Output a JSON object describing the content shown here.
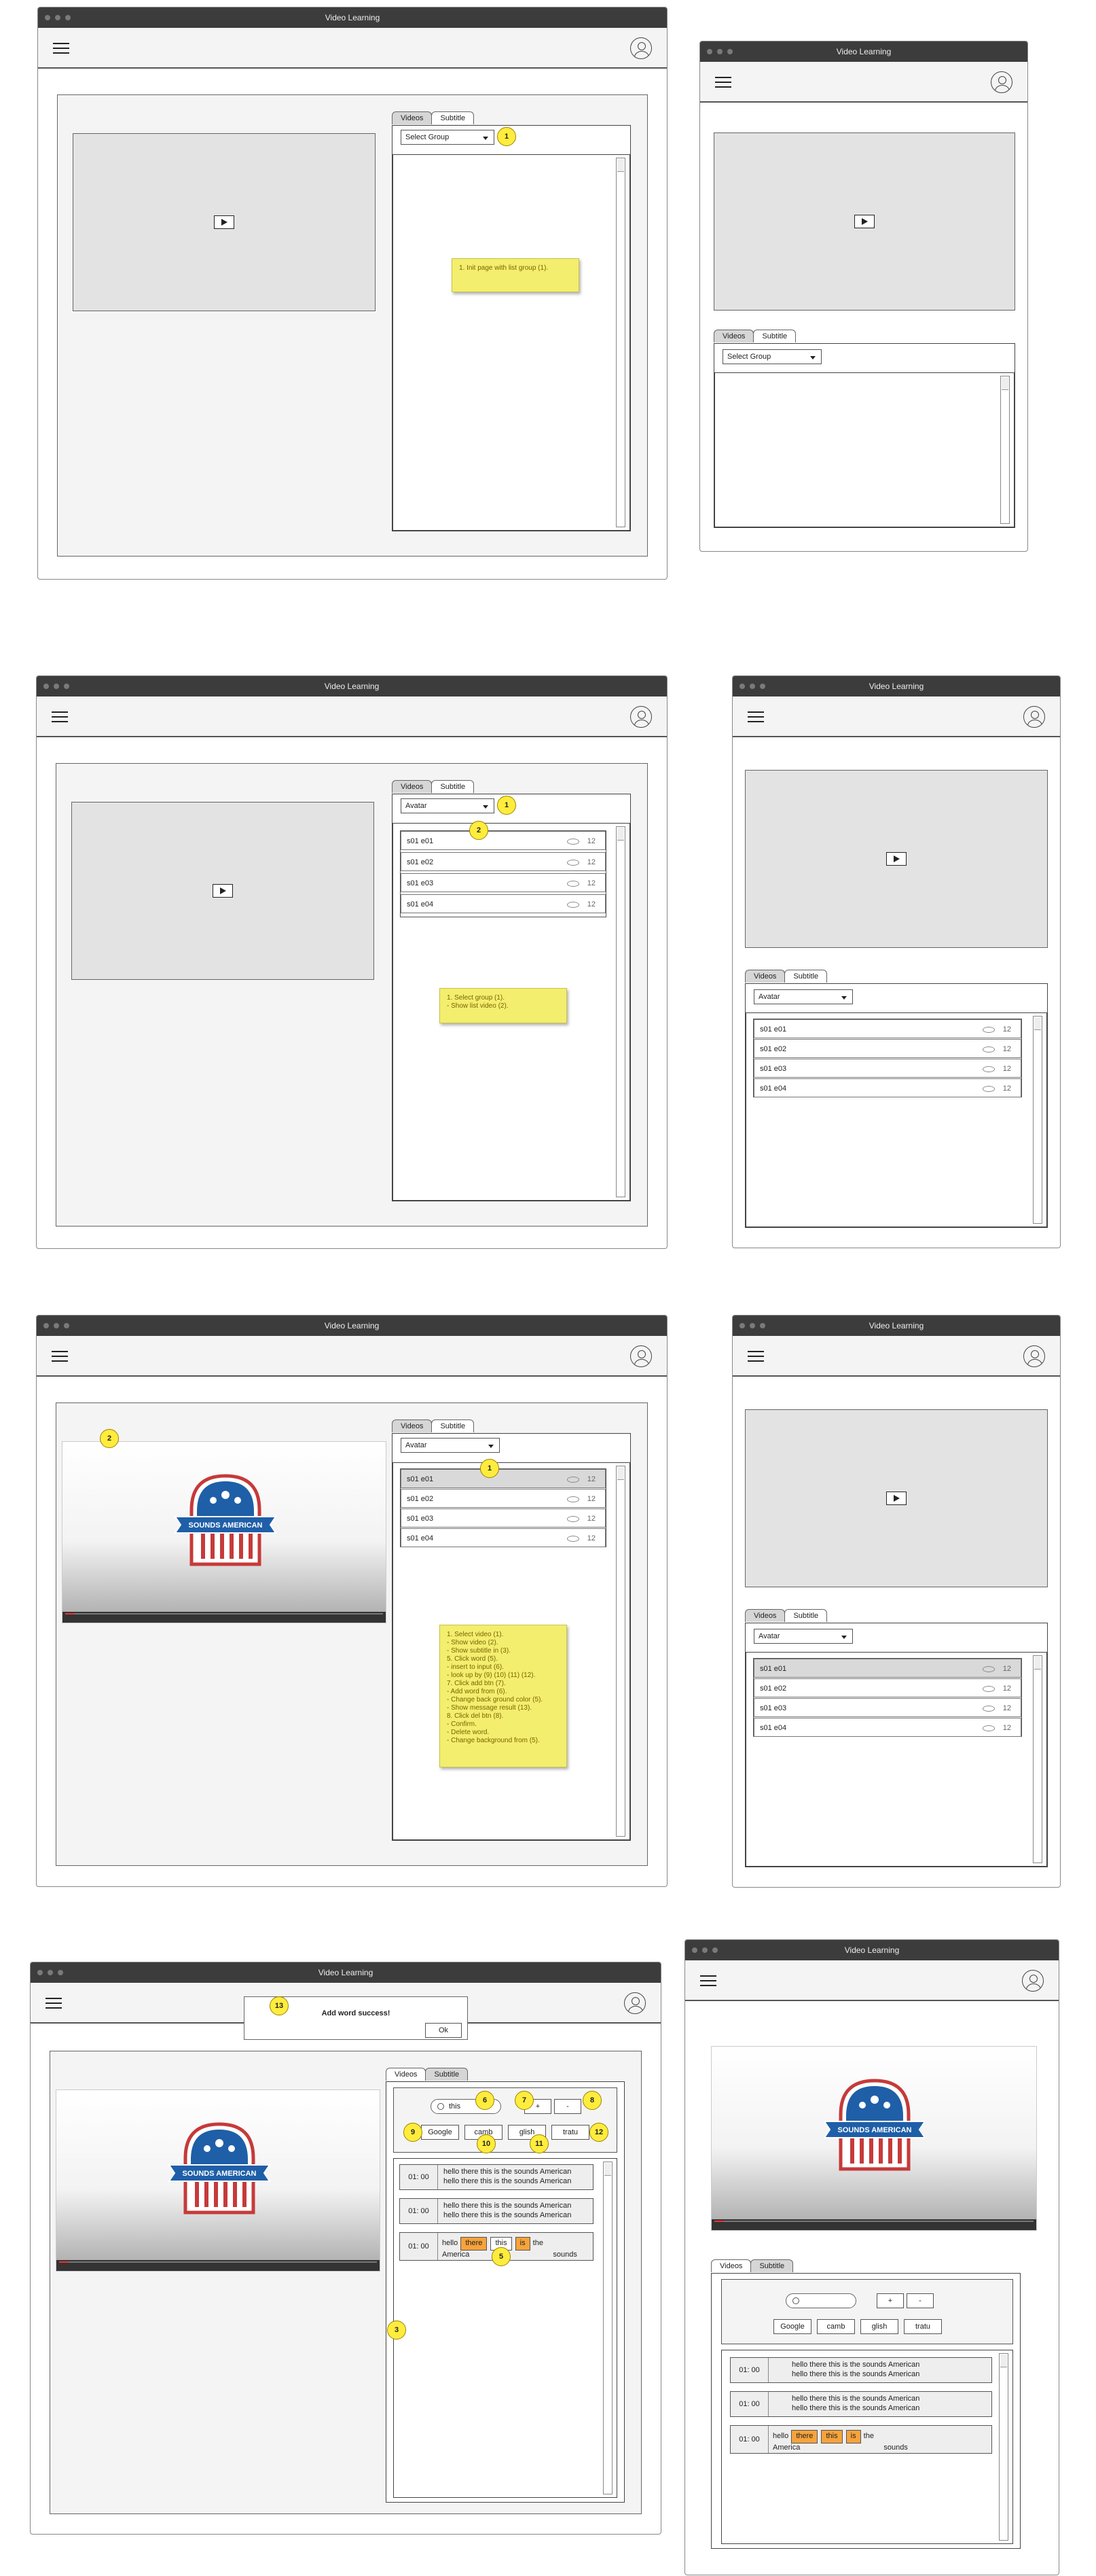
{
  "app": {
    "window_title": "Video Learning"
  },
  "tabs": {
    "videos": "Videos",
    "subtitle": "Subtitle"
  },
  "select": {
    "initial": "Select Group",
    "selected": "Avatar"
  },
  "episodes": [
    {
      "title": "s01 e01",
      "views": "12"
    },
    {
      "title": "s01 e02",
      "views": "12"
    },
    {
      "title": "s01 e03",
      "views": "12"
    },
    {
      "title": "s01 e04",
      "views": "12"
    }
  ],
  "notes": {
    "init": "1. Init page with list group (1).",
    "select": "1. Select group (1).\n- Show list video (2).",
    "video": "1. Select video (1).\n- Show video (2).\n- Show subtitle in (3).\n5. Click word (5).\n- insert to input (6).\n- look up by (9) (10) (11) (12).\n7. Click add btn (7).\n- Add word from (6).\n- Change back ground color (5).\n- Show message result (13).\n8. Click del btn (8).\n- Confirm.\n- Delete word.\n- Change background from (5)."
  },
  "badges": [
    "1",
    "2",
    "3",
    "5",
    "6",
    "7",
    "8",
    "9",
    "10",
    "11",
    "12",
    "13"
  ],
  "subtitle_panel": {
    "search_value": "this",
    "add_label": "+",
    "delete_label": "-",
    "dict_buttons": [
      "Google",
      "camb",
      "glish",
      "tratu"
    ],
    "alert_message": "Add word success!",
    "ok_label": "Ok",
    "rows": [
      {
        "time": "01: 00",
        "line1": "hello there this is the sounds American",
        "line2": "hello there this is the sounds American"
      },
      {
        "time": "01: 00",
        "line1": "hello there this is the sounds American",
        "line2": "hello there this is the sounds American"
      }
    ],
    "word_row": {
      "time": "01: 00",
      "w_hello": "hello",
      "w_there": "there",
      "w_this": "this",
      "w_is": "is",
      "w_the": "the",
      "w_america": "America",
      "w_sounds": "sounds"
    }
  },
  "logo": {
    "text": "SOUNDS AMERICAN"
  },
  "colors": {
    "note": "#f3ee6e",
    "badge": "#ffec3d",
    "highlight": "#f6a33b",
    "titlebar": "#3c3c3c"
  },
  "icons": [
    "hamburger-menu-icon",
    "user-avatar-icon",
    "play-icon",
    "eye-icon",
    "search-icon"
  ]
}
